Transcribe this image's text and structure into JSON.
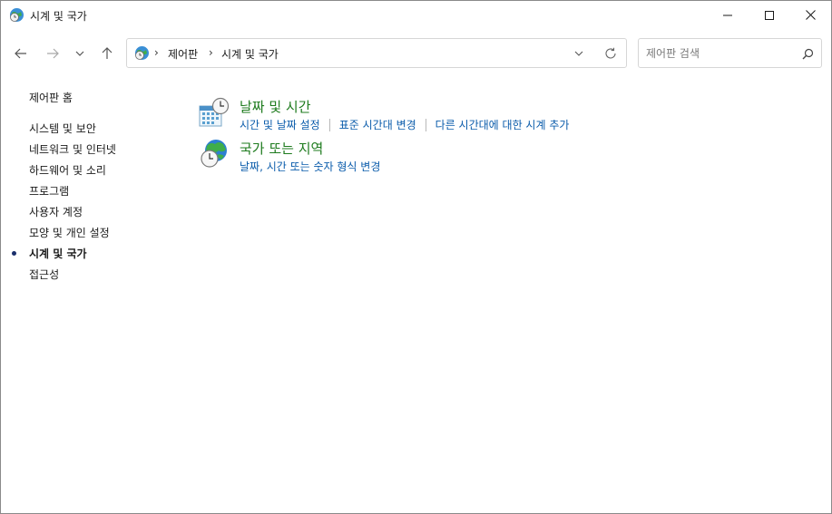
{
  "window": {
    "title": "시계 및 국가"
  },
  "address_bar": {
    "crumbs": [
      "제어판",
      "시계 및 국가"
    ],
    "separator": "›"
  },
  "search": {
    "placeholder": "제어판 검색"
  },
  "left_nav": {
    "home": "제어판 홈",
    "items": [
      {
        "label": "시스템 및 보안",
        "current": false
      },
      {
        "label": "네트워크 및 인터넷",
        "current": false
      },
      {
        "label": "하드웨어 및 소리",
        "current": false
      },
      {
        "label": "프로그램",
        "current": false
      },
      {
        "label": "사용자 계정",
        "current": false
      },
      {
        "label": "모양 및 개인 설정",
        "current": false
      },
      {
        "label": "시계 및 국가",
        "current": true
      },
      {
        "label": "접근성",
        "current": false
      }
    ]
  },
  "categories": [
    {
      "title": "날짜 및 시간",
      "icon": "calendar-clock-icon",
      "links": [
        "시간 및 날짜 설정",
        "표준 시간대 변경",
        "다른 시간대에 대한 시계 추가"
      ]
    },
    {
      "title": "국가 또는 지역",
      "icon": "globe-clock-icon",
      "links": [
        "날짜, 시간 또는 숫자 형식 변경"
      ]
    }
  ],
  "colors": {
    "category_title": "#1e7b1e",
    "link": "#0b5cab",
    "bullet": "#1a2f6b"
  }
}
